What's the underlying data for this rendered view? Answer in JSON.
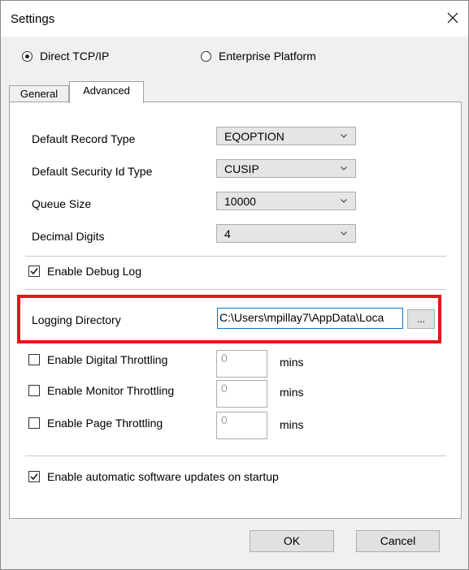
{
  "window": {
    "title": "Settings"
  },
  "connection": {
    "options": [
      "Direct TCP/IP",
      "Enterprise Platform"
    ],
    "selected": "Direct TCP/IP"
  },
  "tabs": [
    {
      "label": "General",
      "active": false
    },
    {
      "label": "Advanced",
      "active": true
    }
  ],
  "advanced": {
    "fields": [
      {
        "label": "Default Record Type",
        "value": "EQOPTION"
      },
      {
        "label": "Default Security Id Type",
        "value": "CUSIP"
      },
      {
        "label": "Queue Size",
        "value": "10000"
      },
      {
        "label": "Decimal Digits",
        "value": "4"
      }
    ],
    "debug_log": {
      "label": "Enable Debug Log",
      "checked": true
    },
    "logging_directory": {
      "label": "Logging Directory",
      "value": "C:\\Users\\mpillay7\\AppData\\Loca",
      "browse_label": "..."
    },
    "throttles": [
      {
        "label": "Enable Digital Throttling",
        "checked": false,
        "value": "0",
        "unit": "mins"
      },
      {
        "label": "Enable Monitor Throttling",
        "checked": false,
        "value": "0",
        "unit": "mins"
      },
      {
        "label": "Enable Page Throttling",
        "checked": false,
        "value": "0",
        "unit": "mins"
      }
    ],
    "auto_update": {
      "label": "Enable automatic software updates on startup",
      "checked": true
    }
  },
  "buttons": {
    "ok": "OK",
    "cancel": "Cancel"
  },
  "colors": {
    "highlight": "#e8141c",
    "focus": "#0078d7"
  }
}
